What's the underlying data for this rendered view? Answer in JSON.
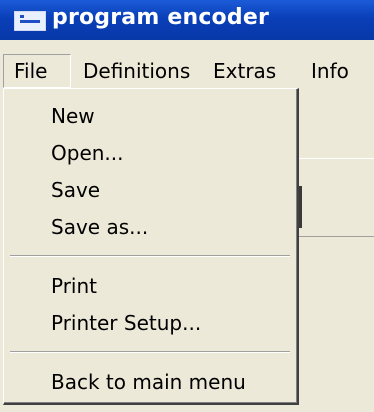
{
  "window": {
    "title": "program encoder"
  },
  "menubar": {
    "items": [
      {
        "label": "File"
      },
      {
        "label": "Definitions"
      },
      {
        "label": "Extras"
      },
      {
        "label": "Info"
      }
    ]
  },
  "file_menu": {
    "items": [
      {
        "label": "New"
      },
      {
        "label": "Open..."
      },
      {
        "label": "Save"
      },
      {
        "label": "Save as..."
      },
      {
        "label": "Print"
      },
      {
        "label": "Printer Setup..."
      },
      {
        "label": "Back to main menu"
      }
    ]
  },
  "colors": {
    "titlebar": "#0a3fb8",
    "menu_background": "#ece9d8"
  },
  "icons": {
    "app": "app-icon"
  }
}
